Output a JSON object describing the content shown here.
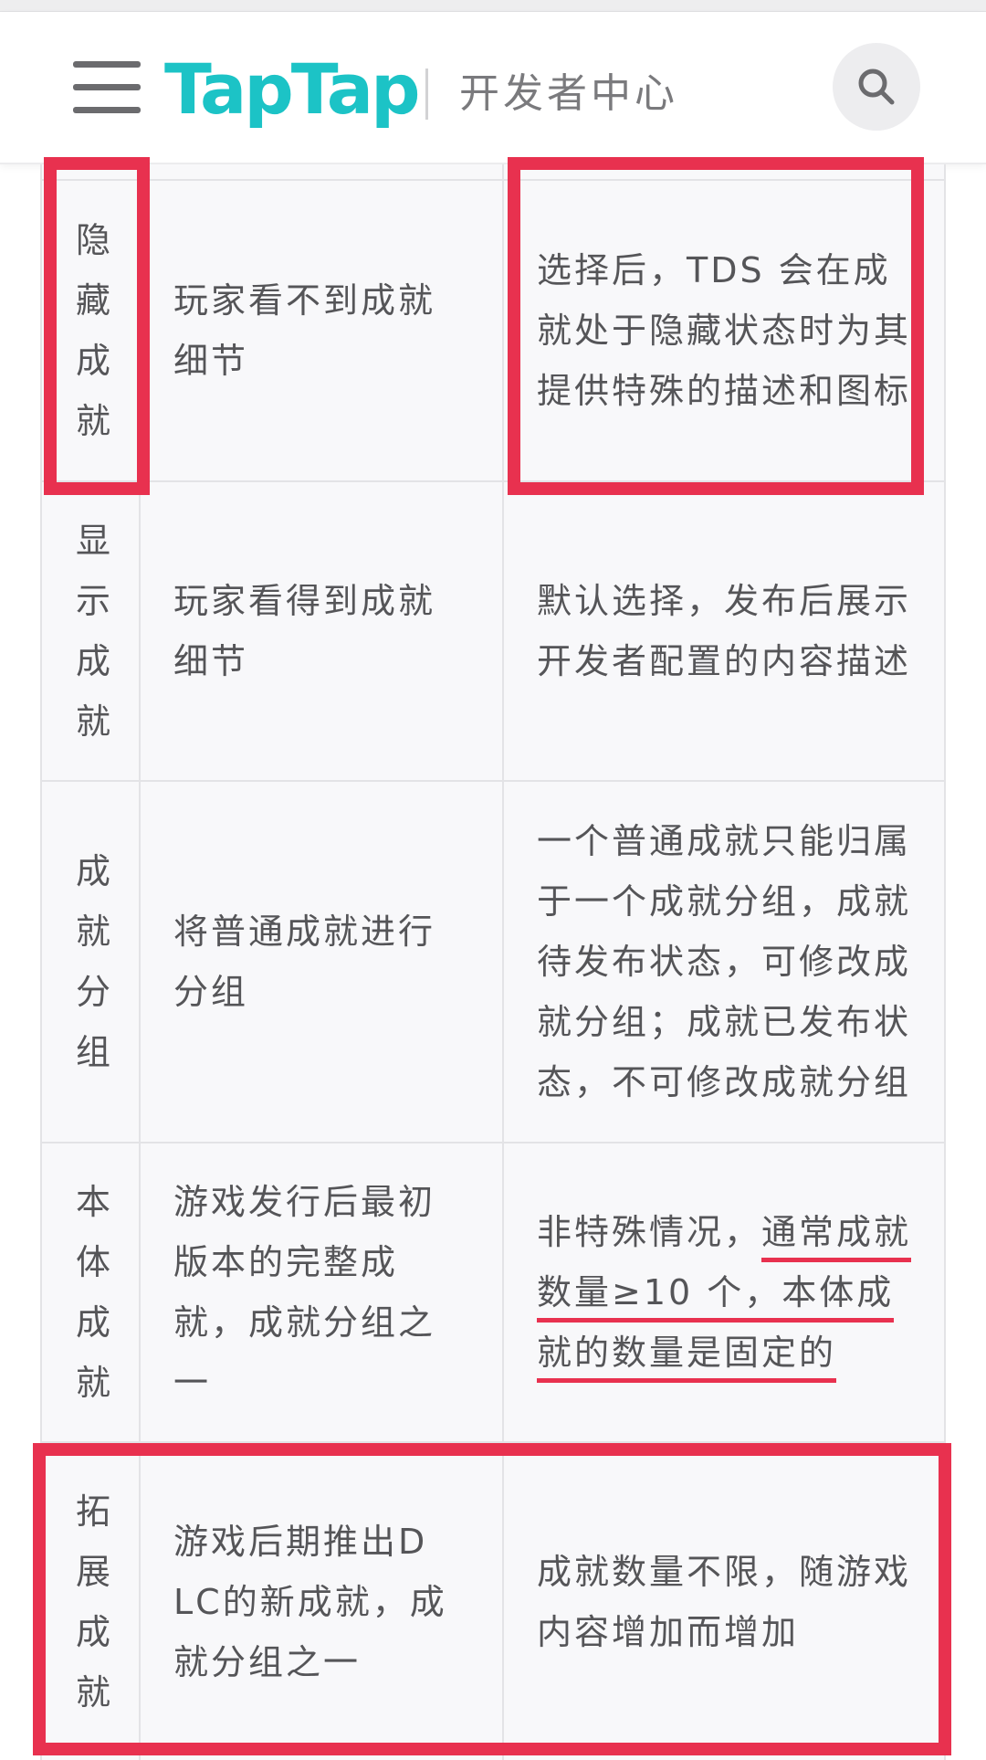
{
  "header": {
    "logo_text": "TapTap",
    "subtitle": "开发者中心",
    "menu_icon": "hamburger-menu-icon",
    "search_icon": "search-icon",
    "brand_color": "#1cc3c6"
  },
  "table": {
    "rows": [
      {
        "name": "隐藏成就",
        "desc": "玩家看不到成就细节",
        "note": "选择后，TDS 会在成就处于隐藏状态时为其提供特殊的描述和图标"
      },
      {
        "name": "显示成就",
        "desc": "玩家看得到成就细节",
        "note": "默认选择，发布后展示开发者配置的内容描述"
      },
      {
        "name": "成就分组",
        "desc": "将普通成就进行分组",
        "note": "一个普通成就只能归属于一个成就分组，成就待发布状态，可修改成就分组；成就已发布状态，不可修改成就分组"
      },
      {
        "name": "本体成就",
        "desc": "游戏发行后最初版本的完整成就，成就分组之一",
        "note_prefix": "非特殊情况，",
        "note_highlight": "通常成就数量≥10 个，本体成就的数量是固定的"
      },
      {
        "name": "拓展成就",
        "desc": "游戏后期推出DLC的新成就，成就分组之一",
        "note": "成就数量不限，随游戏内容增加而增加"
      }
    ]
  },
  "annotations": {
    "highlight_color": "#e8314f"
  }
}
